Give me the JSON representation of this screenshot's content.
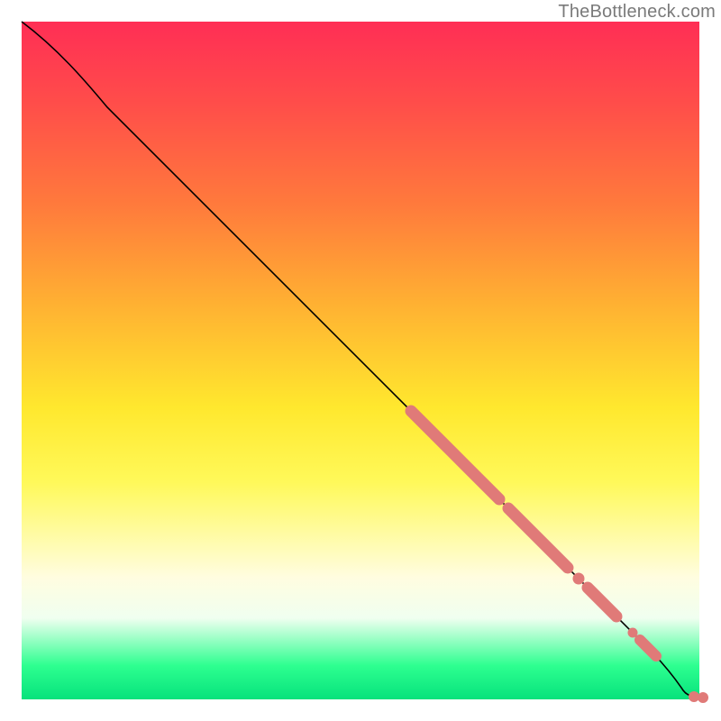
{
  "credit": "TheBottleneck.com",
  "chart_data": {
    "type": "line",
    "title": "",
    "xlabel": "",
    "ylabel": "",
    "xlim": [
      0,
      100
    ],
    "ylim": [
      0,
      100
    ],
    "grid": false,
    "legend": false,
    "background": "vertical-gradient red→orange→yellow→green",
    "series": [
      {
        "name": "curve",
        "style": "black-line",
        "points": [
          {
            "x": 0,
            "y": 100
          },
          {
            "x": 7,
            "y": 93.5
          },
          {
            "x": 12,
            "y": 88
          },
          {
            "x": 58,
            "y": 42
          },
          {
            "x": 92,
            "y": 7
          },
          {
            "x": 95,
            "y": 3
          },
          {
            "x": 97.5,
            "y": 1
          },
          {
            "x": 100,
            "y": 0.8
          }
        ]
      },
      {
        "name": "markers",
        "style": "salmon-dots",
        "points": [
          {
            "x": 58,
            "y": 42
          },
          {
            "x": 60,
            "y": 40
          },
          {
            "x": 62,
            "y": 38
          },
          {
            "x": 64,
            "y": 36
          },
          {
            "x": 66,
            "y": 34
          },
          {
            "x": 68,
            "y": 32
          },
          {
            "x": 70,
            "y": 30
          },
          {
            "x": 72,
            "y": 28
          },
          {
            "x": 74,
            "y": 26
          },
          {
            "x": 76,
            "y": 24
          },
          {
            "x": 78,
            "y": 22
          },
          {
            "x": 80,
            "y": 20
          },
          {
            "x": 82,
            "y": 18
          },
          {
            "x": 84,
            "y": 16
          },
          {
            "x": 86,
            "y": 14
          },
          {
            "x": 88,
            "y": 12
          },
          {
            "x": 90,
            "y": 10
          },
          {
            "x": 92,
            "y": 7
          },
          {
            "x": 98,
            "y": 1
          },
          {
            "x": 100,
            "y": 0.8
          }
        ]
      }
    ]
  }
}
